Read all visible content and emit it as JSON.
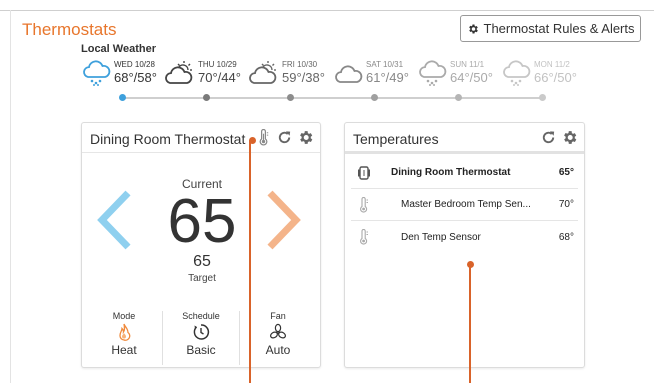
{
  "page": {
    "title": "Thermostats"
  },
  "header": {
    "rules_button_label": "Thermostat Rules & Alerts"
  },
  "weather": {
    "title": "Local Weather",
    "days": [
      {
        "date": "WED 10/28",
        "temps": "68°/58°",
        "icon": "rain-cloud-icon"
      },
      {
        "date": "THU 10/29",
        "temps": "70°/44°",
        "icon": "partly-cloudy-icon"
      },
      {
        "date": "FRI 10/30",
        "temps": "59°/38°",
        "icon": "partly-cloudy-icon"
      },
      {
        "date": "SAT 10/31",
        "temps": "61°/49°",
        "icon": "cloud-icon"
      },
      {
        "date": "SUN 11/1",
        "temps": "64°/50°",
        "icon": "rain-cloud-icon"
      },
      {
        "date": "MON 11/2",
        "temps": "66°/50°",
        "icon": "rain-cloud-icon"
      }
    ]
  },
  "thermostat_card": {
    "title": "Dining Room Thermostat",
    "current_label": "Current",
    "current_value": "65",
    "target_value": "65",
    "target_label": "Target",
    "mode_label": "Mode",
    "mode_value": "Heat",
    "schedule_label": "Schedule",
    "schedule_value": "Basic",
    "fan_label": "Fan",
    "fan_value": "Auto"
  },
  "temperatures_card": {
    "title": "Temperatures",
    "rows": [
      {
        "name": "Dining Room Thermostat",
        "value": "65°"
      },
      {
        "name": "Master Bedroom Temp Sen...",
        "value": "70°"
      },
      {
        "name": "Den Temp Sensor",
        "value": "68°"
      }
    ]
  },
  "colors": {
    "accent": "#e8762c",
    "cool_arrow": "#8fd0ef",
    "warm_arrow": "#f4b48a",
    "active_dot": "#3ea0dc",
    "annotation": "#d9632a"
  }
}
